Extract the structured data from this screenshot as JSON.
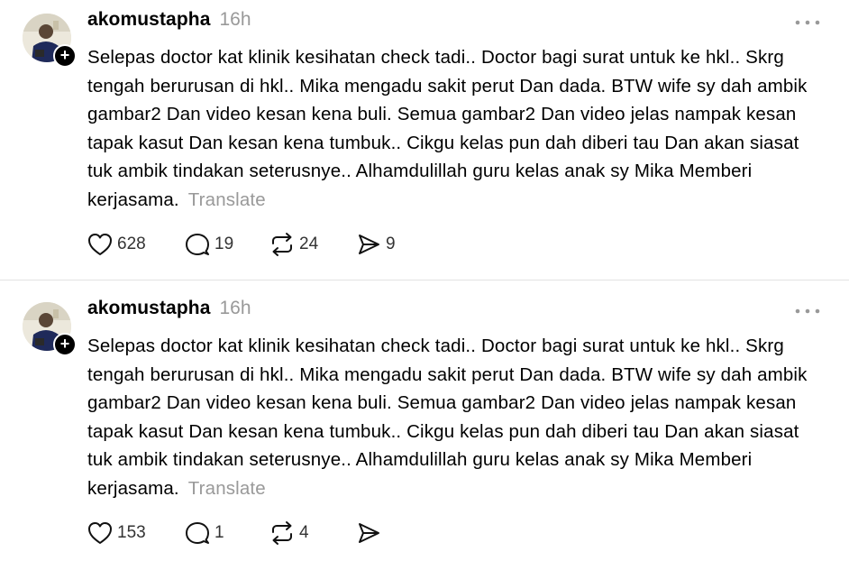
{
  "colors": {
    "text": "#000000",
    "muted": "#999999",
    "divider": "#e2e2e2"
  },
  "posts": [
    {
      "username": "akomustapha",
      "timestamp": "16h",
      "body": "Selepas doctor kat klinik kesihatan check tadi.. Doctor bagi surat untuk ke hkl.. Skrg tengah berurusan di hkl.. Mika mengadu sakit perut Dan dada. BTW wife sy dah ambik gambar2 Dan video kesan kena buli. Semua gambar2 Dan video jelas nampak kesan tapak kasut Dan kesan kena tumbuk.. Cikgu kelas pun dah diberi tau Dan akan siasat tuk ambik tindakan seterusnye.. Alhamdulillah guru kelas anak sy Mika Memberi kerjasama.",
      "translate_label": "Translate",
      "likes": "628",
      "replies": "19",
      "reposts": "24",
      "shares": "9",
      "icons": [
        "avatar-photo",
        "plus-icon",
        "more-icon",
        "heart-icon",
        "comment-icon",
        "repost-icon",
        "send-icon"
      ]
    },
    {
      "username": "akomustapha",
      "timestamp": "16h",
      "body": "Selepas doctor kat klinik kesihatan check tadi.. Doctor bagi surat untuk ke hkl.. Skrg tengah berurusan di hkl.. Mika mengadu sakit perut Dan dada. BTW wife sy dah ambik gambar2 Dan video kesan kena buli. Semua gambar2 Dan video jelas nampak kesan tapak kasut Dan kesan kena tumbuk.. Cikgu kelas pun dah diberi tau Dan akan siasat tuk ambik tindakan seterusnye.. Alhamdulillah guru kelas anak sy Mika Memberi kerjasama.",
      "translate_label": "Translate",
      "likes": "153",
      "replies": "1",
      "reposts": "4",
      "shares": "",
      "icons": [
        "avatar-photo",
        "plus-icon",
        "more-icon",
        "heart-icon",
        "comment-icon",
        "repost-icon",
        "send-icon"
      ]
    }
  ]
}
